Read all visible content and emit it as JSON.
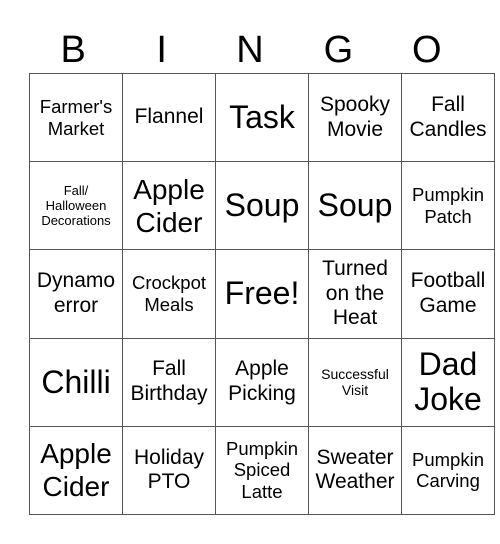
{
  "header": [
    "B",
    "I",
    "N",
    "G",
    "O"
  ],
  "cells": [
    [
      "Farmer's Market",
      "Flannel",
      "Task",
      "Spooky Movie",
      "Fall Candles"
    ],
    [
      "Fall/ Halloween Decorations",
      "Apple Cider",
      "Soup",
      "Soup",
      "Pumpkin Patch"
    ],
    [
      "Dynamo error",
      "Crockpot Meals",
      "Free!",
      "Turned on the Heat",
      "Football Game"
    ],
    [
      "Chilli",
      "Fall Birthday",
      "Apple Picking",
      "Successful Visit",
      "Dad Joke"
    ],
    [
      "Apple Cider",
      "Holiday PTO",
      "Pumpkin Spiced Latte",
      "Sweater Weather",
      "Pumpkin Carving"
    ]
  ]
}
